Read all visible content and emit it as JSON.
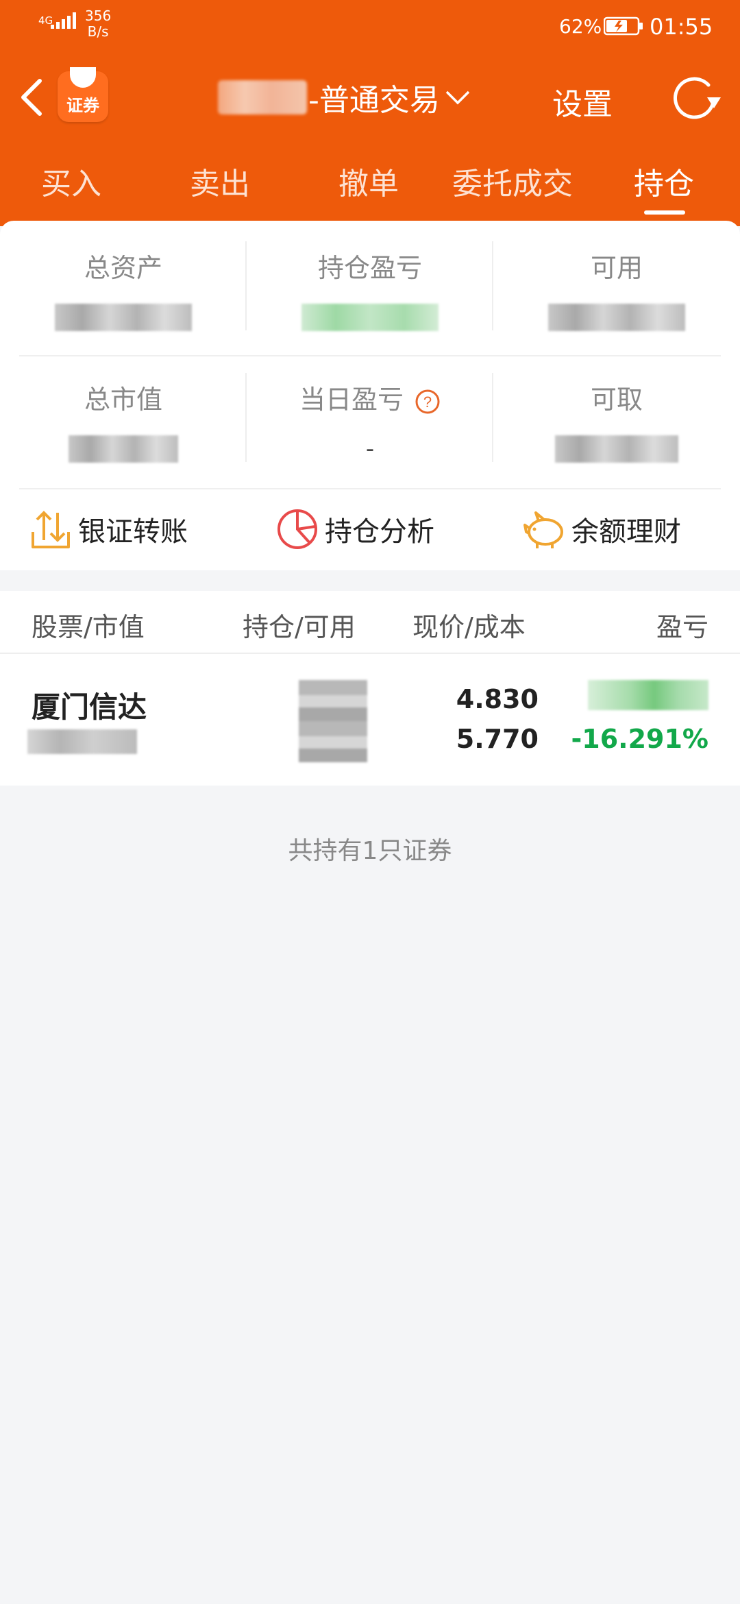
{
  "status_bar": {
    "network": "4G",
    "speed_value": "356",
    "speed_unit": "B/s",
    "battery": "62%",
    "time": "01:55"
  },
  "nav": {
    "logo_text": "证券",
    "title": "-普通交易",
    "settings_label": "设置"
  },
  "tabs": [
    {
      "label": "买入"
    },
    {
      "label": "卖出"
    },
    {
      "label": "撤单"
    },
    {
      "label": "委托成交"
    },
    {
      "label": "持仓"
    }
  ],
  "active_tab": "持仓",
  "summary": {
    "total_assets_label": "总资产",
    "position_pl_label": "持仓盈亏",
    "available_label": "可用",
    "market_value_label": "总市值",
    "daily_pl_label": "当日盈亏",
    "daily_pl_value": "-",
    "withdrawable_label": "可取"
  },
  "quick_actions": {
    "transfer": "银证转账",
    "analysis": "持仓分析",
    "wealth": "余额理财"
  },
  "holdings_table": {
    "columns": [
      "股票/市值",
      "持仓/可用",
      "现价/成本",
      "盈亏"
    ],
    "rows": [
      {
        "name": "厦门信达",
        "current_price": "4.830",
        "cost": "5.770",
        "pl_percent": "-16.291%"
      }
    ]
  },
  "footer_note": "共持有1只证券",
  "colors": {
    "header_bg": "#ee5a0b",
    "loss_green": "#12a84a",
    "help_orange": "#e8672a"
  }
}
